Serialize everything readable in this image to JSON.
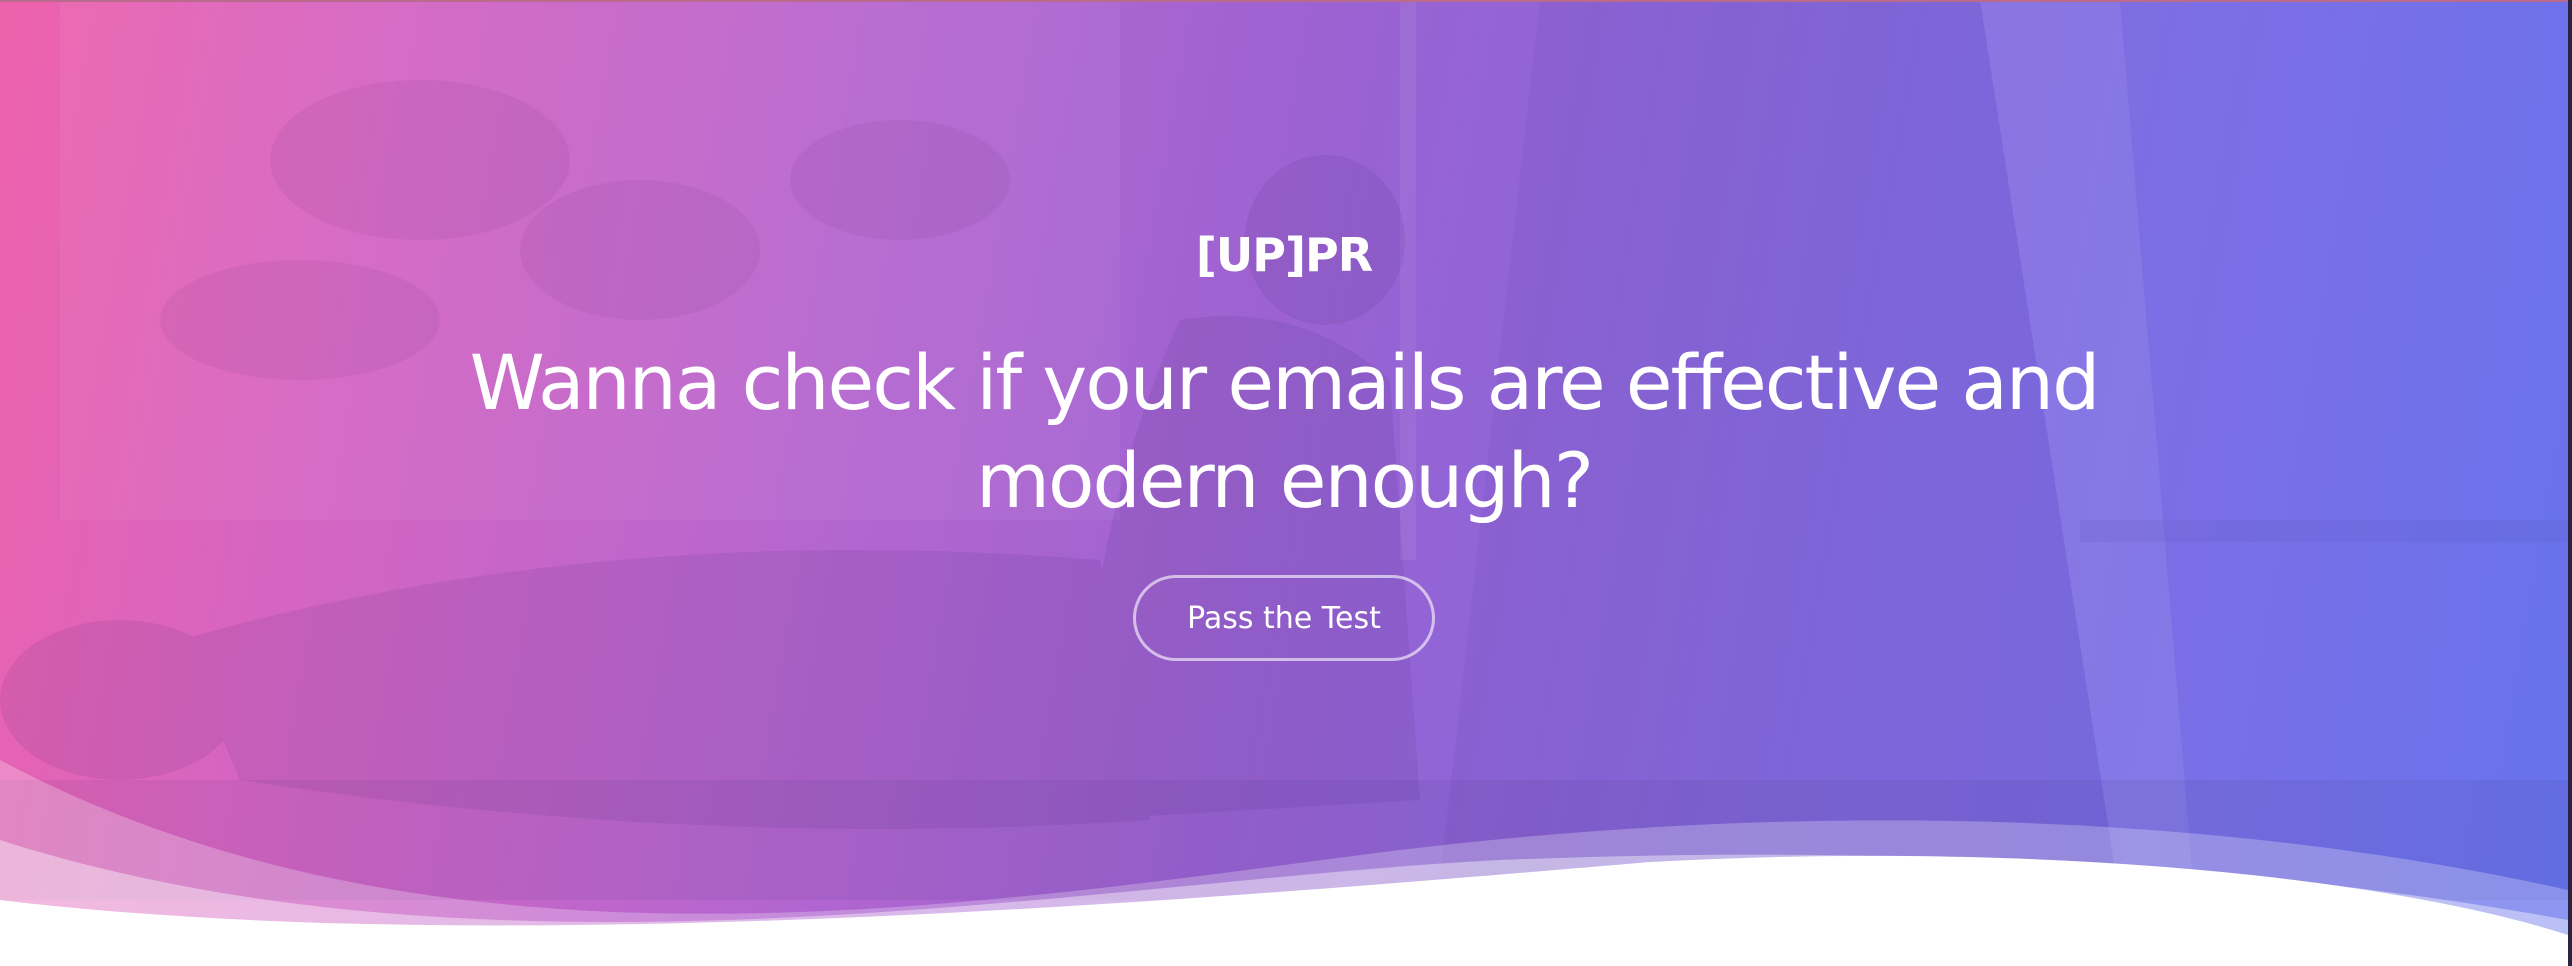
{
  "hero": {
    "logo_text": "[UP]PR",
    "headline": "Wanna check if your emails are effective and modern enough?",
    "cta_label": "Pass the Test"
  },
  "colors": {
    "gradient_left": "#ee62ac",
    "gradient_mid": "#9a62d2",
    "gradient_right": "#6673ec",
    "text": "#ffffff",
    "button_border": "rgba(255,255,255,0.6)"
  }
}
